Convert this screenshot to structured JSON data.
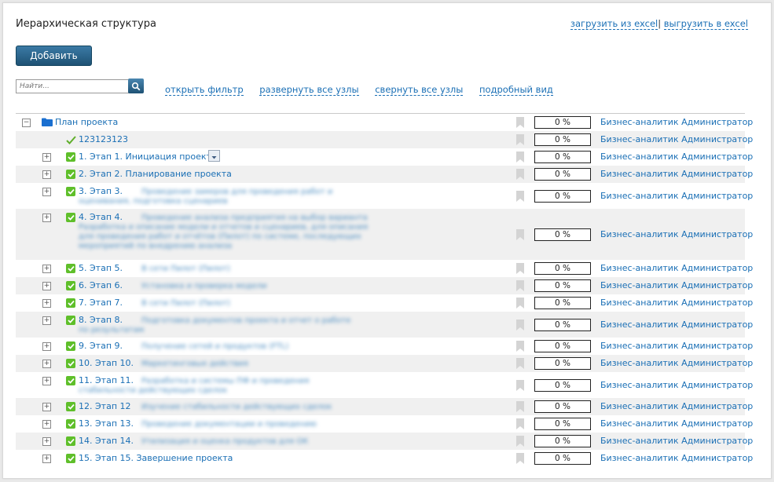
{
  "header": {
    "title": "Иерархическая структура",
    "import_label": "загрузить из excel",
    "export_label": "выгрузить в excel",
    "separator": "|"
  },
  "toolbar": {
    "add_label": "Добавить",
    "search_placeholder": "Найти...",
    "open_filter": "открыть фильтр",
    "expand_all": "развернуть все узлы",
    "collapse_all": "свернуть все узлы",
    "detailed_view": "подробный вид"
  },
  "tree": {
    "root": {
      "label": "План проекта",
      "percent": "0 %",
      "assignee": "Бизнес-аналитик Администратор",
      "toggle": "−"
    },
    "leaf": {
      "label": "123123123",
      "percent": "0 %",
      "assignee": "Бизнес-аналитик Администратор"
    },
    "stages": [
      {
        "label": "1. Этап 1. Инициация проекта",
        "percent": "0 %",
        "assignee": "Бизнес-аналитик Администратор",
        "toggle": "+"
      },
      {
        "label": "2. Этап 2. Планирование проекта",
        "percent": "0 %",
        "assignee": "Бизнес-аналитик Администратор",
        "toggle": "+"
      },
      {
        "label": "3. Этап 3.",
        "percent": "0 %",
        "assignee": "Бизнес-аналитик Администратор",
        "toggle": "+"
      },
      {
        "label": "4. Этап 4.",
        "percent": "0 %",
        "assignee": "Бизнес-аналитик Администратор",
        "toggle": "+"
      },
      {
        "label": "5. Этап 5.",
        "percent": "0 %",
        "assignee": "Бизнес-аналитик Администратор",
        "toggle": "+"
      },
      {
        "label": "6. Этап 6.",
        "percent": "0 %",
        "assignee": "Бизнес-аналитик Администратор",
        "toggle": "+"
      },
      {
        "label": "7. Этап 7.",
        "percent": "0 %",
        "assignee": "Бизнес-аналитик Администратор",
        "toggle": "+"
      },
      {
        "label": "8. Этап 8.",
        "percent": "0 %",
        "assignee": "Бизнес-аналитик Администратор",
        "toggle": "+"
      },
      {
        "label": "9. Этап 9.",
        "percent": "0 %",
        "assignee": "Бизнес-аналитик Администратор",
        "toggle": "+"
      },
      {
        "label": "10. Этап 10.",
        "percent": "0 %",
        "assignee": "Бизнес-аналитик Администратор",
        "toggle": "+"
      },
      {
        "label": "11. Этап 11.",
        "percent": "0 %",
        "assignee": "Бизнес-аналитик Администратор",
        "toggle": "+"
      },
      {
        "label": "12. Этап 12",
        "percent": "0 %",
        "assignee": "Бизнес-аналитик Администратор",
        "toggle": "+"
      },
      {
        "label": "13. Этап 13.",
        "percent": "0 %",
        "assignee": "Бизнес-аналитик Администратор",
        "toggle": "+"
      },
      {
        "label": "14. Этап 14.",
        "percent": "0 %",
        "assignee": "Бизнес-аналитик Администратор",
        "toggle": "+"
      },
      {
        "label": "15. Этап 15. Завершение проекта",
        "percent": "0 %",
        "assignee": "Бизнес-аналитик Администратор",
        "toggle": "+"
      }
    ]
  },
  "colors": {
    "link": "#1a6fb5",
    "button": "#1e5274",
    "check": "#5fbf2a",
    "row_alt": "#f0f0f0"
  },
  "icons": [
    "search-icon",
    "folder-icon",
    "checkmark-icon",
    "check-icon",
    "bookmark-icon",
    "expand-icon",
    "collapse-icon",
    "dropdown-icon"
  ]
}
